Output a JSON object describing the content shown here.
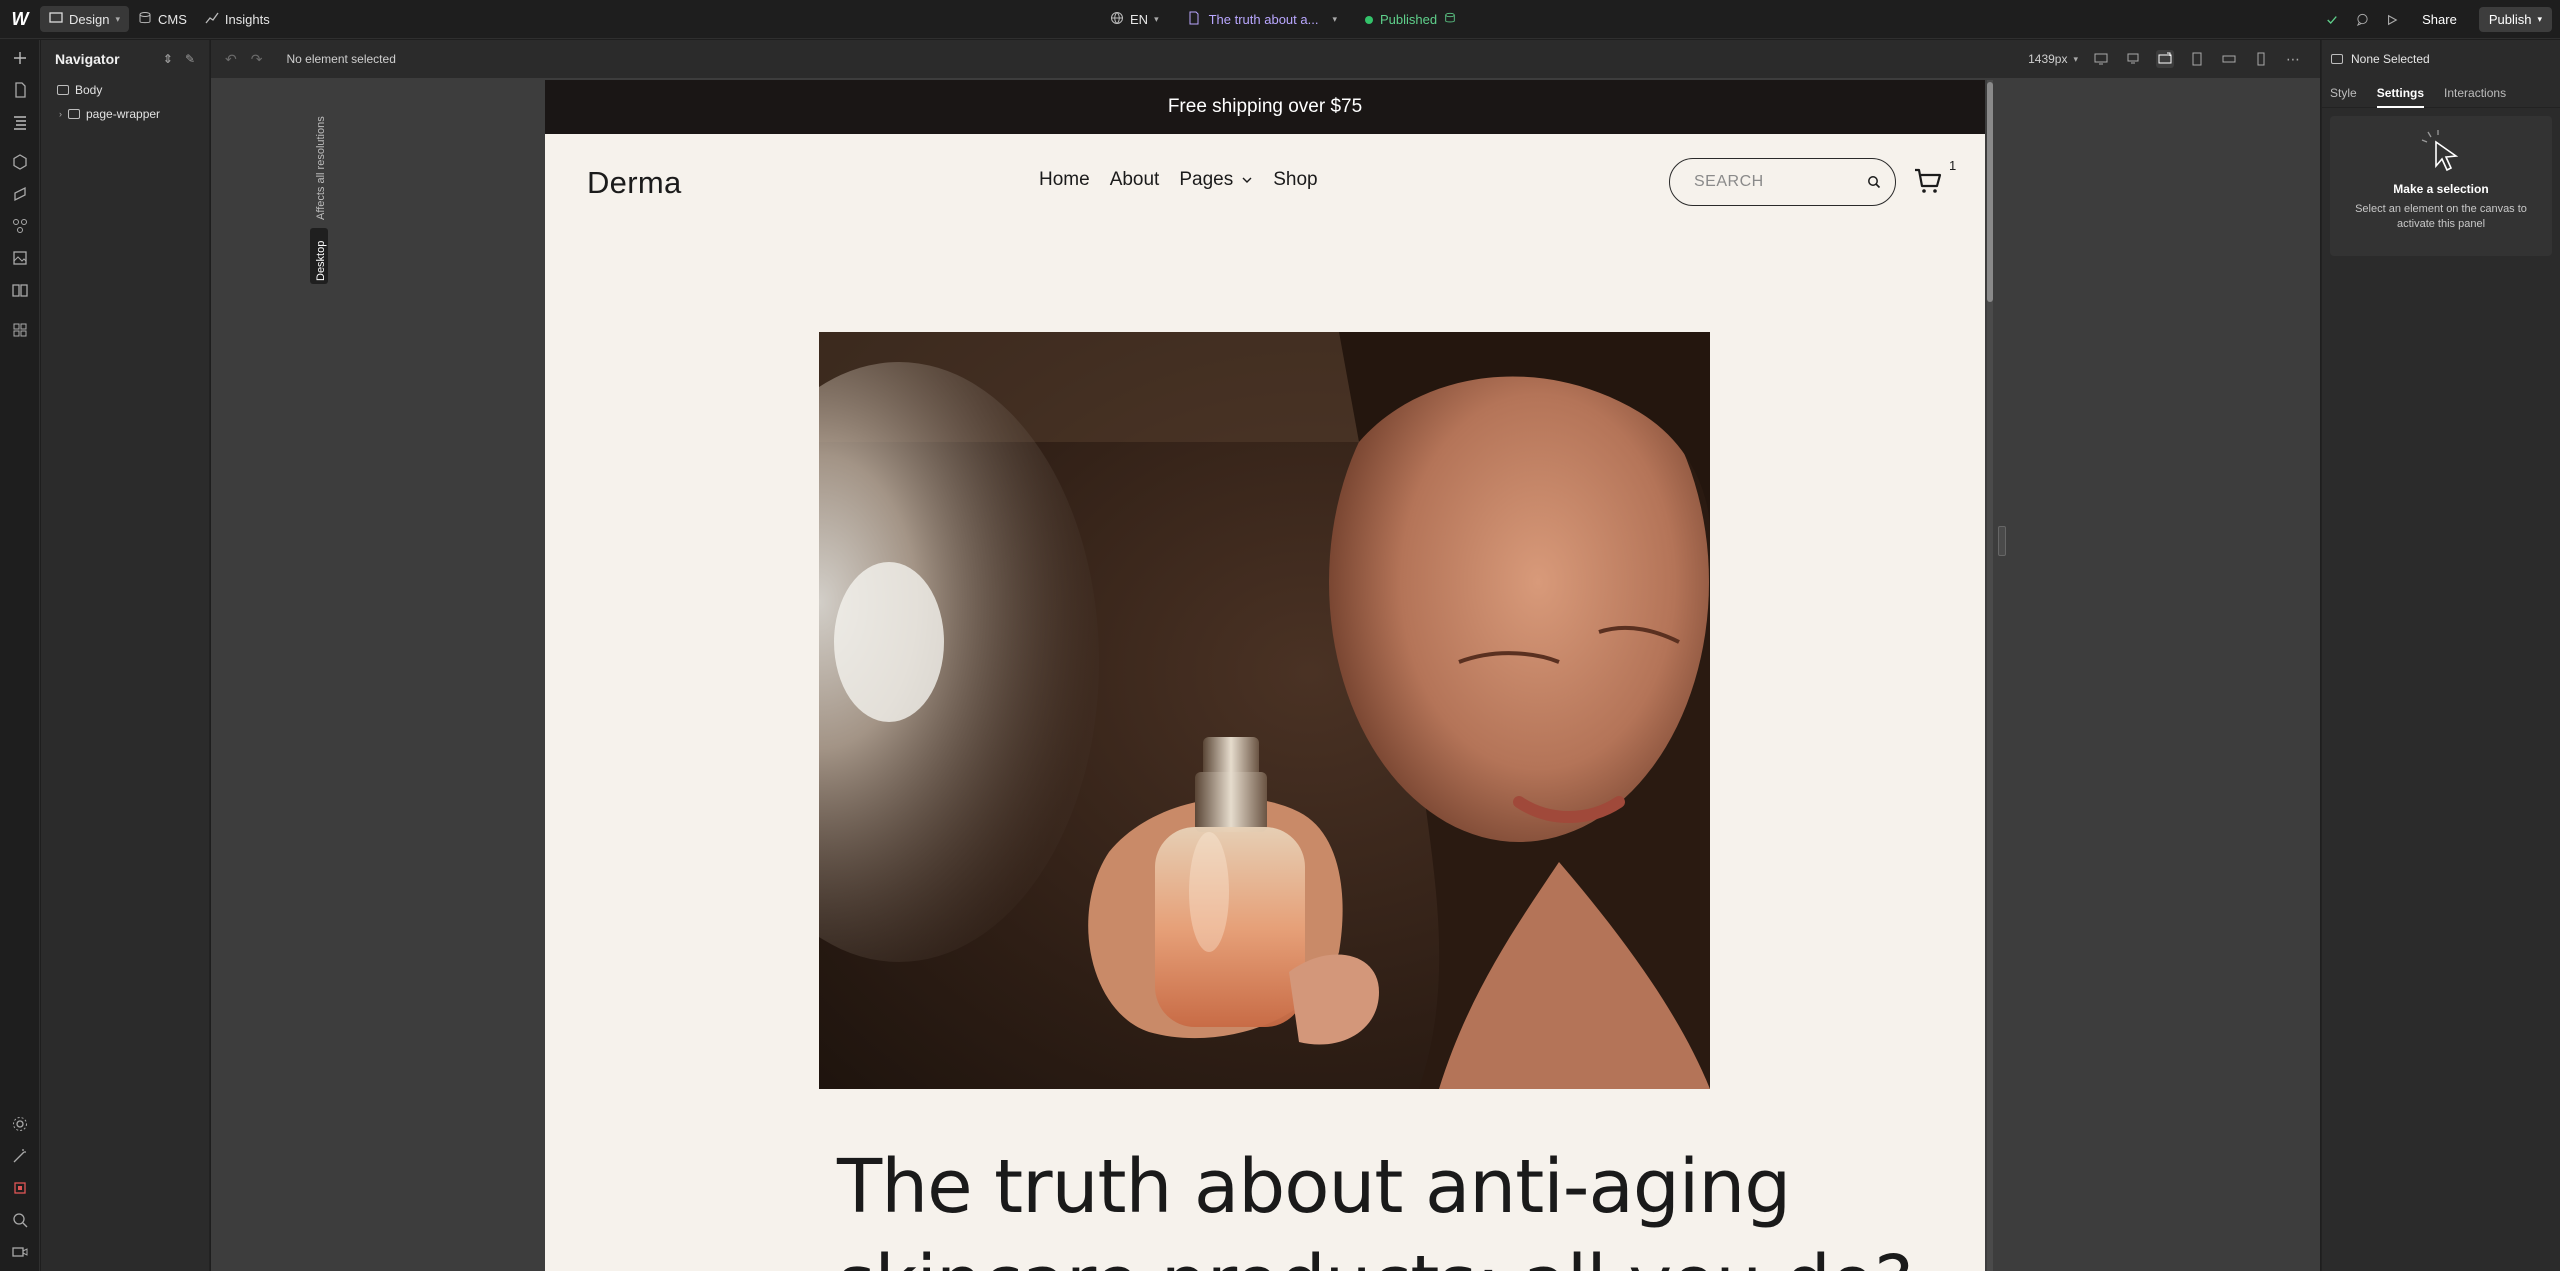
{
  "topbar": {
    "design_label": "Design",
    "cms_label": "CMS",
    "insights_label": "Insights",
    "locale": "EN",
    "page_name": "The truth about a...",
    "status": "Published",
    "share_label": "Share",
    "publish_label": "Publish"
  },
  "navigator": {
    "title": "Navigator",
    "items": [
      {
        "label": "Body"
      },
      {
        "label": "page-wrapper"
      }
    ]
  },
  "canvas_toolbar": {
    "selection_status": "No element selected",
    "width_value": "1439px"
  },
  "breakpoint_labels": {
    "affects": "Affects all resolutions",
    "desktop": "Desktop"
  },
  "site": {
    "announcement": "Free shipping over $75",
    "brand": "Derma",
    "menu": [
      "Home",
      "About",
      "Pages",
      "Shop"
    ],
    "search_placeholder": "SEARCH",
    "cart_count": "1",
    "headline_line1": "The truth about anti-aging",
    "headline_line2": "skincare products: all you do?"
  },
  "right_panel": {
    "selection_label": "None Selected",
    "tabs": [
      "Style",
      "Settings",
      "Interactions"
    ],
    "active_tab": "Settings",
    "empty_title": "Make a selection",
    "empty_desc": "Select an element on the canvas to activate this panel"
  },
  "colors": {
    "app_bg": "#1e1e1e",
    "panel_bg": "#2b2b2b",
    "canvas_bg": "#3d3d3d",
    "site_bg": "#f6f2ec",
    "announcement_bg": "#1a1615",
    "published_green": "#33c26a",
    "page_link_purple": "#b9a7ff"
  }
}
